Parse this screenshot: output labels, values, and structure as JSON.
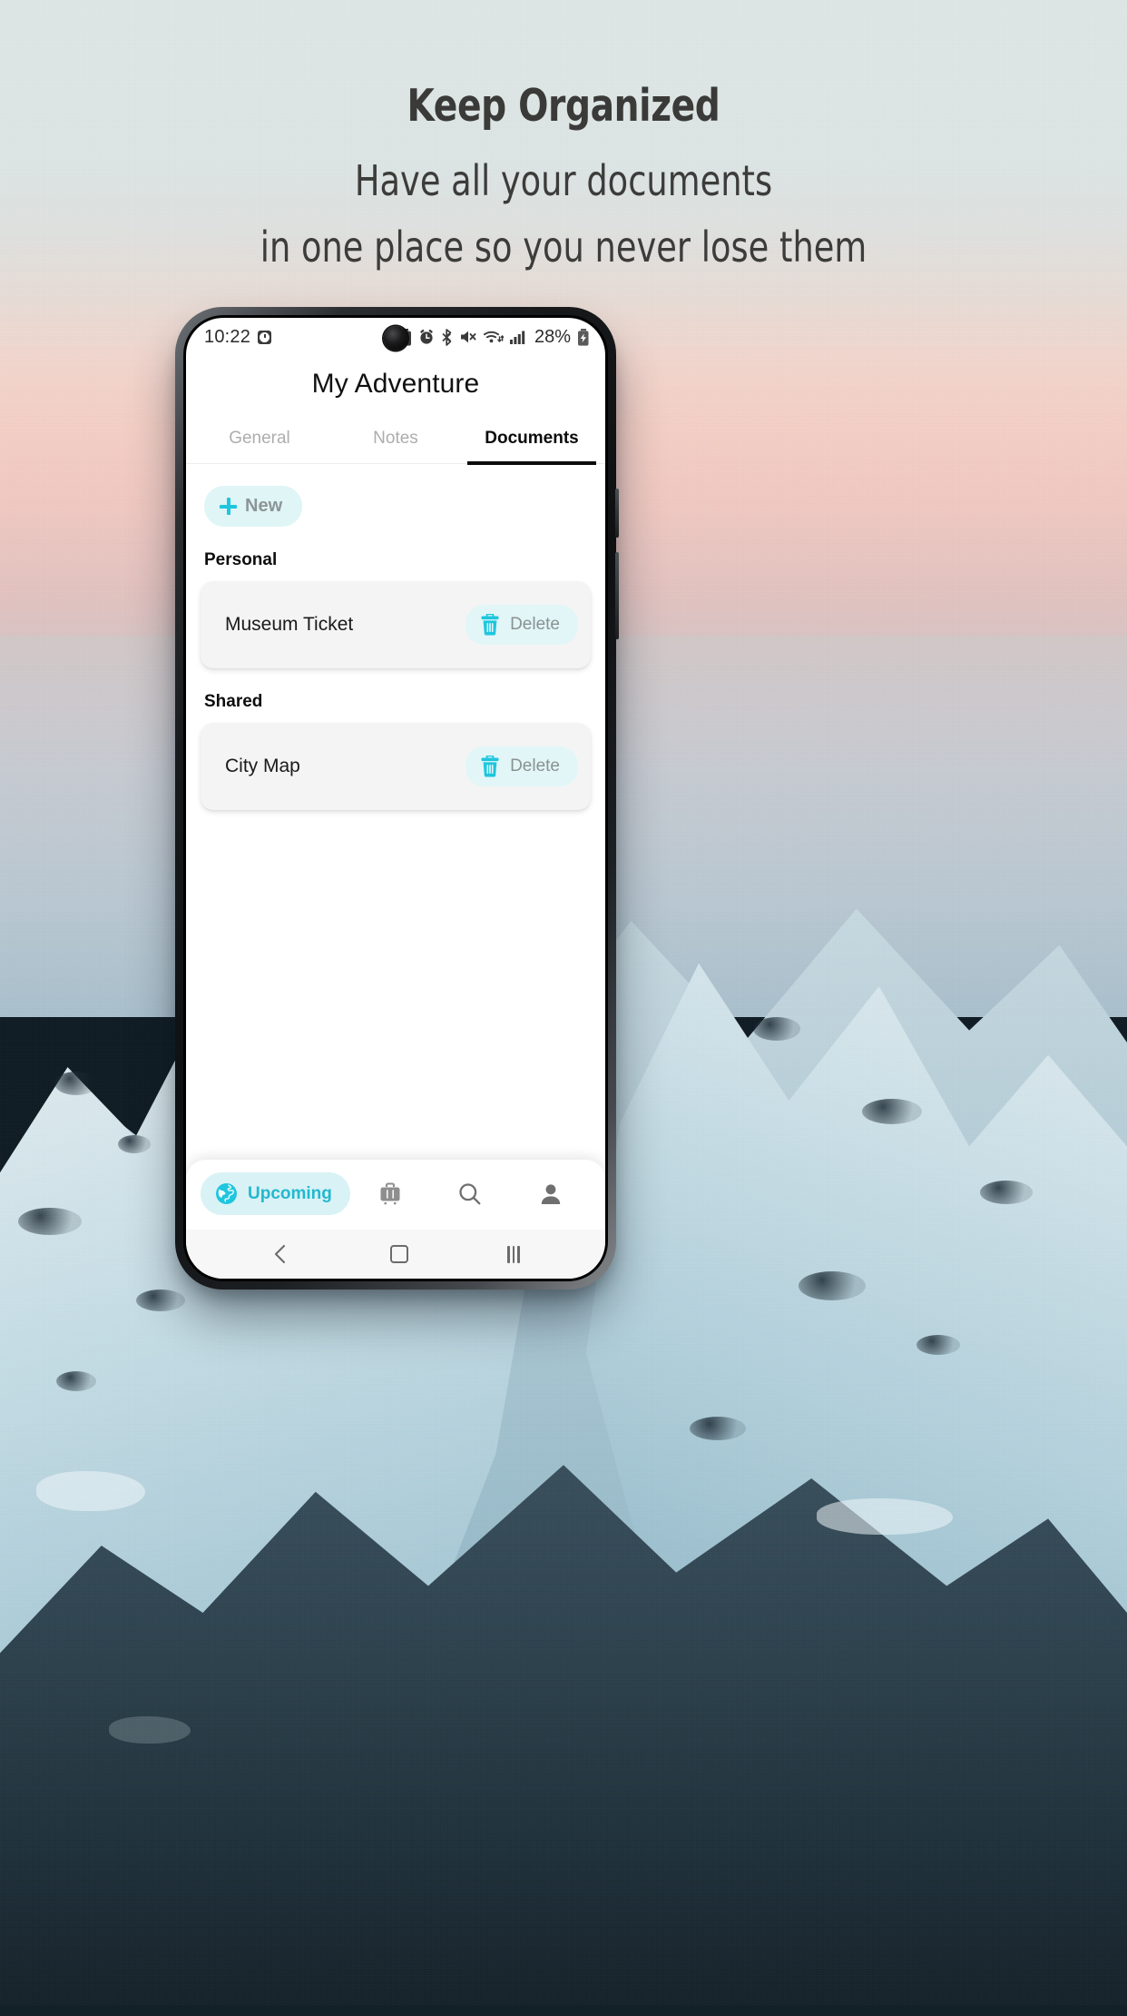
{
  "promo": {
    "headline": "Keep Organized",
    "subtitle_line1": "Have all your documents",
    "subtitle_line2": "in one place so you never lose them"
  },
  "status_bar": {
    "time": "10:22",
    "clock_icon": "alarm-clock-icon",
    "icons": [
      "battery-saver-icon",
      "alarm-icon",
      "bluetooth-icon",
      "mute-icon",
      "wifi-icon",
      "signal-icon"
    ],
    "battery_percent": "28%",
    "battery_icon": "battery-charging-icon"
  },
  "app": {
    "title": "My Adventure",
    "tabs": [
      {
        "label": "General",
        "active": false
      },
      {
        "label": "Notes",
        "active": false
      },
      {
        "label": "Documents",
        "active": true
      }
    ],
    "new_button": {
      "label": "New",
      "icon": "plus-icon"
    },
    "sections": [
      {
        "title": "Personal",
        "items": [
          {
            "name": "Museum Ticket",
            "action_label": "Delete",
            "action_icon": "trash-icon"
          }
        ]
      },
      {
        "title": "Shared",
        "items": [
          {
            "name": "City Map",
            "action_label": "Delete",
            "action_icon": "trash-icon"
          }
        ]
      }
    ],
    "bottom_nav": [
      {
        "label": "Upcoming",
        "icon": "globe-icon",
        "active": true
      },
      {
        "label": "",
        "icon": "luggage-icon",
        "active": false
      },
      {
        "label": "",
        "icon": "search-icon",
        "active": false
      },
      {
        "label": "",
        "icon": "person-icon",
        "active": false
      }
    ]
  },
  "android_nav": {
    "back": "back-icon",
    "home": "home-icon",
    "recents": "recents-icon"
  },
  "colors": {
    "accent": "#1ec6de",
    "accent_pill": "#d9f2f5",
    "card": "#f4f4f4",
    "tab_inactive": "#adadad",
    "headline": "#3a3a38"
  }
}
